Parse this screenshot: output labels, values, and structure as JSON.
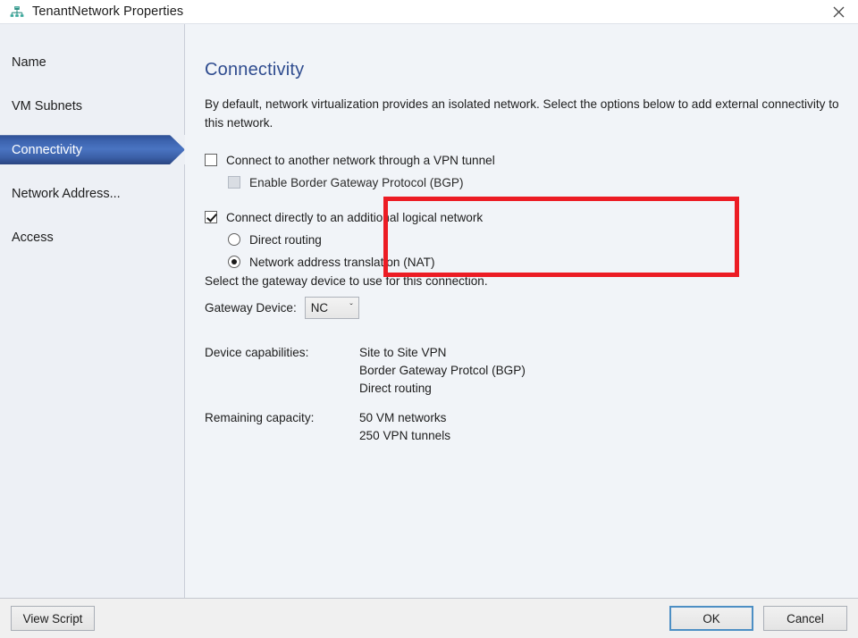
{
  "window": {
    "title": "TenantNetwork Properties",
    "icon": "network-properties-icon",
    "close_label": "✕"
  },
  "sidebar": {
    "items": [
      {
        "label": "Name",
        "selected": false
      },
      {
        "label": "VM Subnets",
        "selected": false
      },
      {
        "label": "Connectivity",
        "selected": true
      },
      {
        "label": "Network Address...",
        "selected": false
      },
      {
        "label": "Access",
        "selected": false
      }
    ]
  },
  "main": {
    "title": "Connectivity",
    "description": "By default, network virtualization provides an isolated network. Select the options below to add external connectivity to this network.",
    "options": {
      "vpn_tunnel": {
        "label": "Connect to another network through a VPN tunnel",
        "checked": false
      },
      "bgp": {
        "label": "Enable Border Gateway Protocol (BGP)",
        "checked": false,
        "disabled": true
      },
      "logical_network": {
        "label": "Connect directly to an additional logical network",
        "checked": true
      },
      "direct_routing": {
        "label": "Direct routing",
        "selected": false
      },
      "nat": {
        "label": "Network address translation (NAT)",
        "selected": true
      }
    },
    "gateway": {
      "hint": "Select the gateway device to use for this connection.",
      "label": "Gateway Device:",
      "value": "NC",
      "chevron": "ˇ"
    },
    "details": [
      {
        "key": "Device capabilities:",
        "values": [
          "Site to Site VPN",
          "Border Gateway Protcol (BGP)",
          "Direct routing"
        ]
      },
      {
        "key": "Remaining capacity:",
        "values": [
          "50 VM networks",
          "250 VPN tunnels"
        ]
      }
    ]
  },
  "footer": {
    "view_script": "View Script",
    "ok": "OK",
    "cancel": "Cancel"
  },
  "colors": {
    "accent_blue": "#2f4c8f",
    "selected_nav": "#3b62ad",
    "highlight_red": "#ec1c24",
    "sidebar_bg": "#edf0f5",
    "main_bg": "#f1f4f8",
    "icon_teal": "#2a9d8f"
  }
}
